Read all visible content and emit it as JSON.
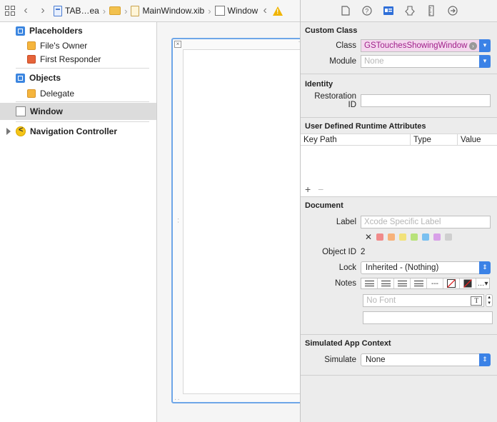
{
  "jumpbar": {
    "project": "TAB…ea",
    "file": "MainWindow.xib",
    "object": "Window"
  },
  "outline": {
    "sections": [
      {
        "title": "Placeholders",
        "items": [
          "File's Owner",
          "First Responder"
        ]
      },
      {
        "title": "Objects",
        "items": [
          "Delegate"
        ]
      }
    ],
    "window_label": "Window",
    "nav_controller_label": "Navigation Controller"
  },
  "inspector": {
    "custom_class": {
      "title": "Custom Class",
      "class_label": "Class",
      "class_value": "GSTouchesShowingWindow",
      "module_label": "Module",
      "module_placeholder": "None"
    },
    "identity": {
      "title": "Identity",
      "restoration_label": "Restoration ID",
      "restoration_value": ""
    },
    "runtime_attributes": {
      "title": "User Defined Runtime Attributes",
      "columns": [
        "Key Path",
        "Type",
        "Value"
      ],
      "add": "+",
      "remove": "−"
    },
    "document": {
      "title": "Document",
      "label_label": "Label",
      "label_placeholder": "Xcode Specific Label",
      "object_id_label": "Object ID",
      "object_id_value": "2",
      "lock_label": "Lock",
      "lock_value": "Inherited - (Nothing)",
      "notes_label": "Notes",
      "font_placeholder": "No Font",
      "colors": [
        "#f08a8a",
        "#f7b27a",
        "#f2e27a",
        "#b8e27a",
        "#7ac0f0",
        "#d8a0e8",
        "#cfcfcf"
      ]
    },
    "simulated": {
      "title": "Simulated App Context",
      "simulate_label": "Simulate",
      "simulate_value": "None"
    }
  },
  "accent_color": "#3b82e6"
}
